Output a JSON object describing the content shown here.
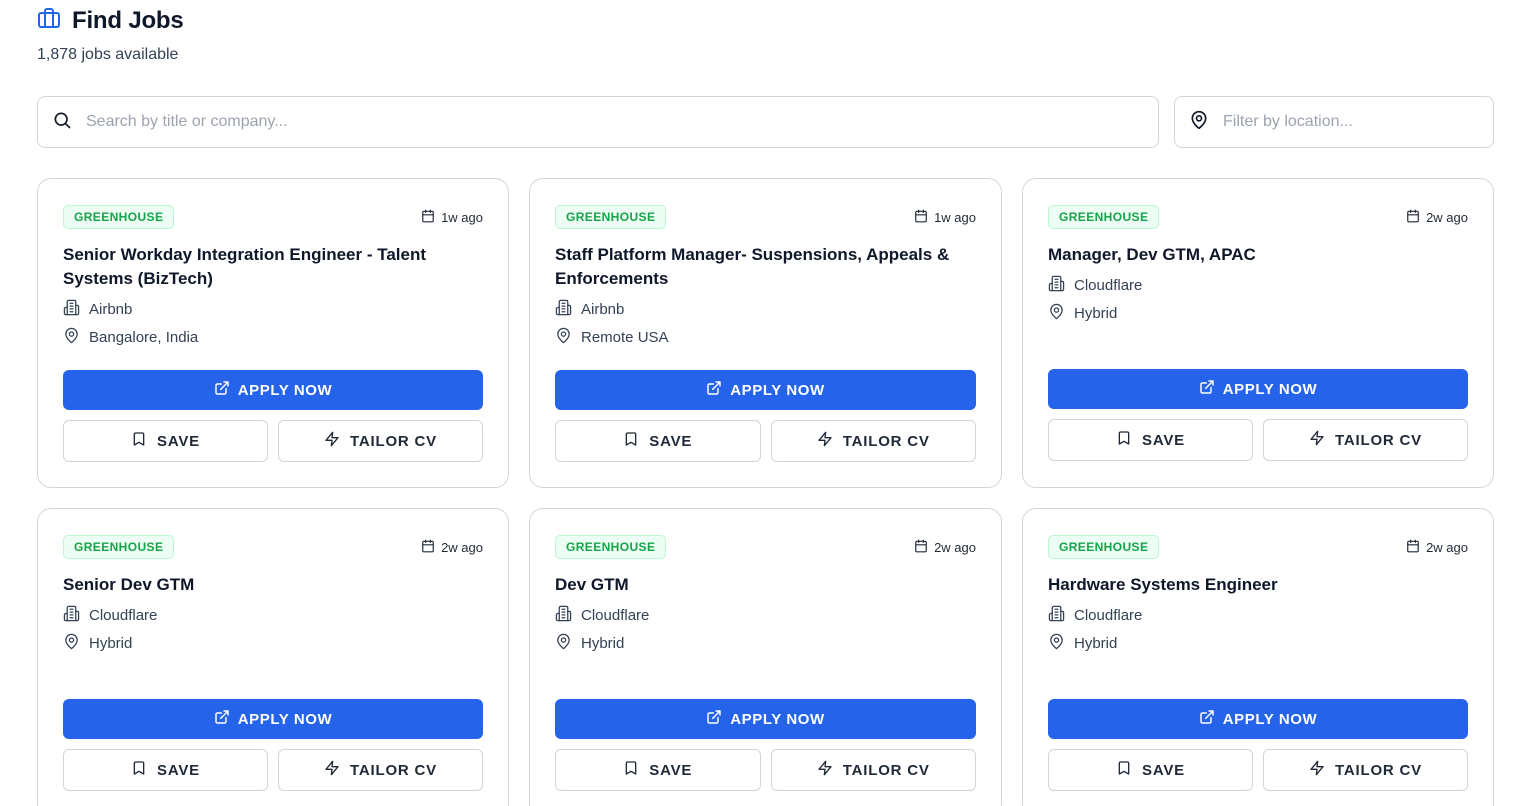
{
  "header": {
    "title": "Find Jobs",
    "icon": "briefcase-icon",
    "job_count": "1,878 jobs available",
    "accent": "#2563eb"
  },
  "search": {
    "placeholder": "Search by title or company...",
    "value": "",
    "icon": "search-icon"
  },
  "location_filter": {
    "placeholder": "Filter by location...",
    "value": "",
    "icon": "map-pin-icon"
  },
  "labels": {
    "apply": "APPLY NOW",
    "save": "SAVE",
    "tailor": "TAILOR CV"
  },
  "colors": {
    "primary": "#2563eb",
    "badge_text": "#16a34a",
    "badge_bg": "#ecfdf3"
  },
  "jobs": [
    {
      "source": "GREENHOUSE",
      "posted": "1w ago",
      "title": "Senior Workday Integration Engineer - Talent Systems (BizTech)",
      "company": "Airbnb",
      "location": "Bangalore, India"
    },
    {
      "source": "GREENHOUSE",
      "posted": "1w ago",
      "title": "Staff Platform Manager- Suspensions, Appeals & Enforcements",
      "company": "Airbnb",
      "location": "Remote USA"
    },
    {
      "source": "GREENHOUSE",
      "posted": "2w ago",
      "title": "Manager, Dev GTM, APAC",
      "company": "Cloudflare",
      "location": "Hybrid"
    },
    {
      "source": "GREENHOUSE",
      "posted": "2w ago",
      "title": "Senior Dev GTM",
      "company": "Cloudflare",
      "location": "Hybrid"
    },
    {
      "source": "GREENHOUSE",
      "posted": "2w ago",
      "title": "Dev GTM",
      "company": "Cloudflare",
      "location": "Hybrid"
    },
    {
      "source": "GREENHOUSE",
      "posted": "2w ago",
      "title": "Hardware Systems Engineer",
      "company": "Cloudflare",
      "location": "Hybrid"
    }
  ]
}
